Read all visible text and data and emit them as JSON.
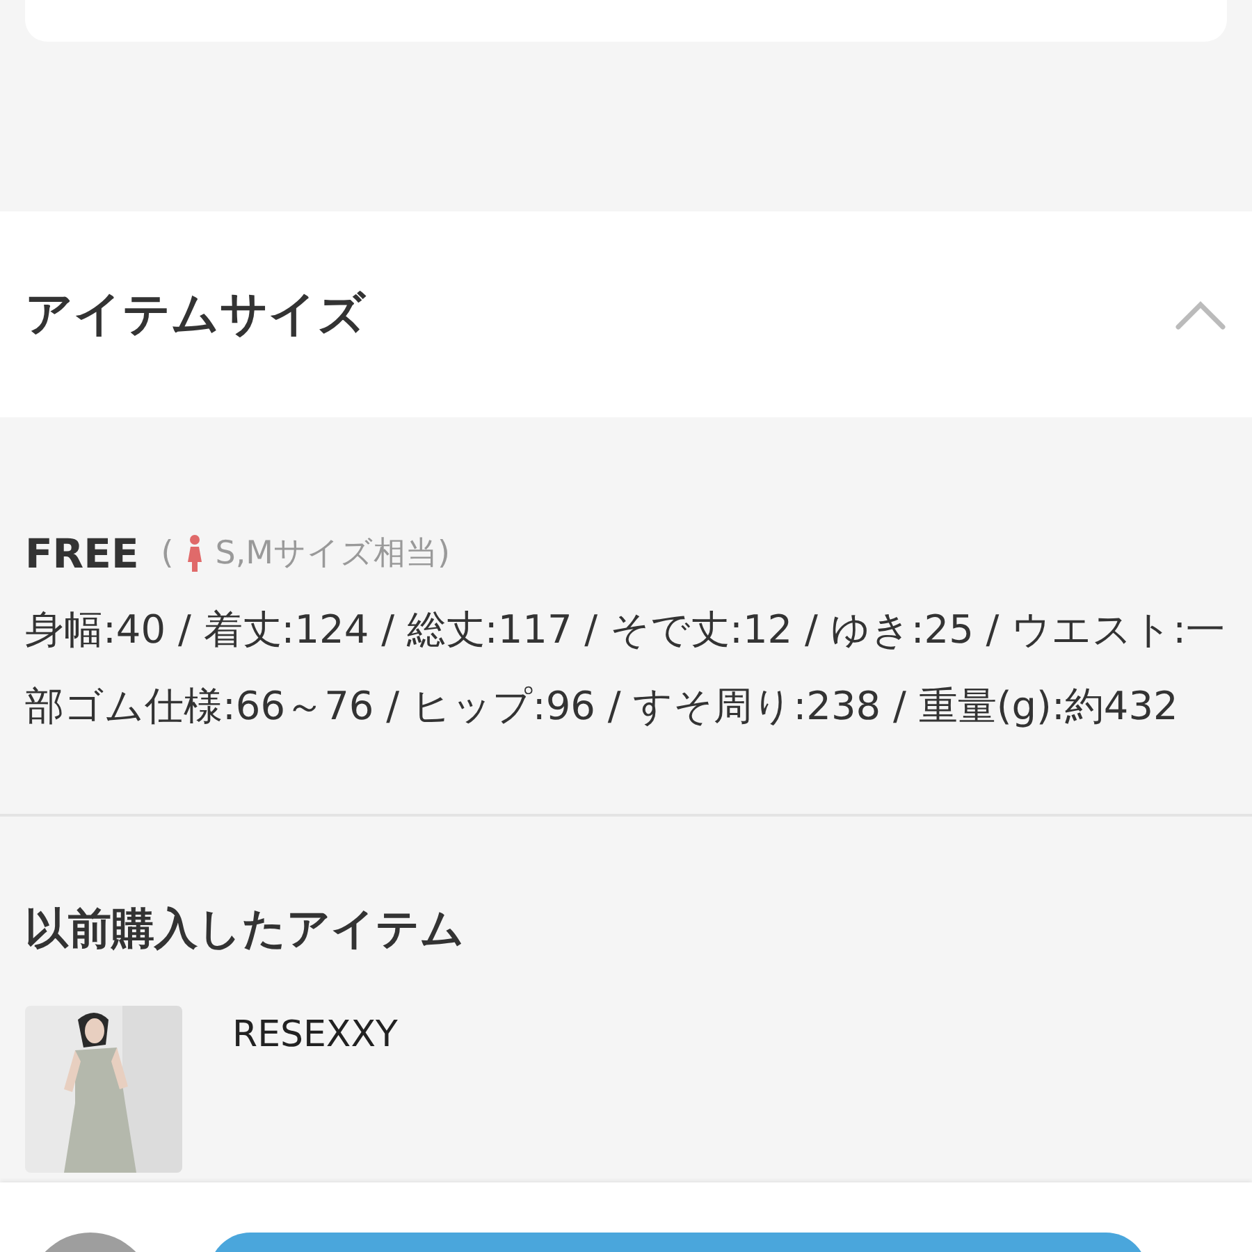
{
  "section": {
    "title": "アイテムサイズ",
    "expanded": true
  },
  "size": {
    "name": "FREE",
    "open": "(",
    "equivalent": "S,Mサイズ相当)",
    "details": "身幅:40 / 着丈:124 / 総丈:117 / そで丈:12 / ゆき:25 / ウエスト:一部ゴム仕様:66～76 / ヒップ:96 / すそ周り:238 / 重量(g):約432"
  },
  "previous": {
    "title": "以前購入したアイテム",
    "items": [
      {
        "kind": "picture",
        "brand": "RESEXXY"
      }
    ]
  }
}
